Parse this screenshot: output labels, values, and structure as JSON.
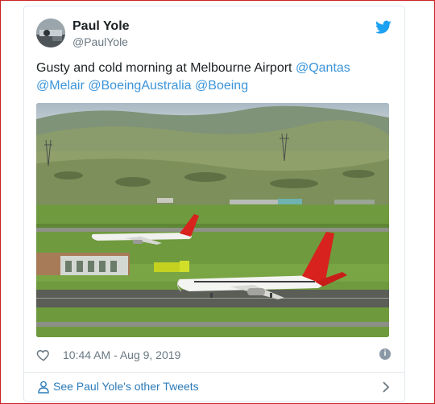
{
  "author": {
    "name": "Paul Yole",
    "handle": "@PaulYole"
  },
  "tweet": {
    "text_lead": "Gusty and cold morning at Melbourne Airport ",
    "mentions": [
      "@Qantas",
      "@Melair",
      "@BoeingAustralia",
      "@Boeing"
    ]
  },
  "meta": {
    "timestamp": "10:44 AM - Aug 9, 2019",
    "info_glyph": "i"
  },
  "footer": {
    "more_tweets_label": "See Paul Yole's other Tweets"
  },
  "colors": {
    "link": "#3b94d9",
    "twitter_blue": "#1da1f2",
    "qantas_red": "#d7221d"
  },
  "icons": {
    "brand": "twitter-bird-icon",
    "like": "heart-icon",
    "info": "info-icon",
    "profile": "person-icon",
    "navigate": "chevron-right-icon"
  }
}
